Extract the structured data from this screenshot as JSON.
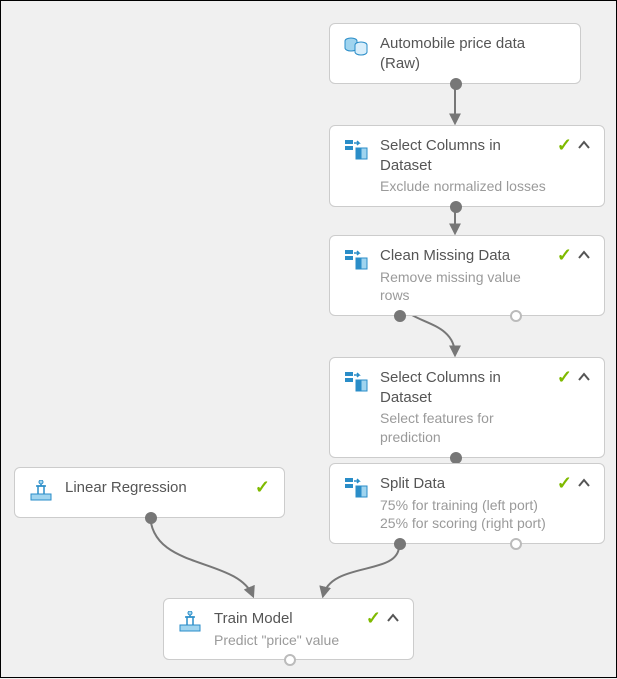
{
  "nodes": {
    "data": {
      "title": "Automobile price data (Raw)"
    },
    "select1": {
      "title": "Select Columns in Dataset",
      "subtitle": "Exclude normalized losses"
    },
    "clean": {
      "title": "Clean Missing Data",
      "subtitle": "Remove missing value rows"
    },
    "select2": {
      "title": "Select Columns in Dataset",
      "subtitle": "Select features for prediction"
    },
    "linreg": {
      "title": "Linear Regression"
    },
    "split": {
      "title": "Split Data",
      "subtitle_line1": "75% for training (left port)",
      "subtitle_line2": "25% for scoring (right port)"
    },
    "train": {
      "title": "Train Model",
      "subtitle": "Predict \"price\" value"
    }
  }
}
